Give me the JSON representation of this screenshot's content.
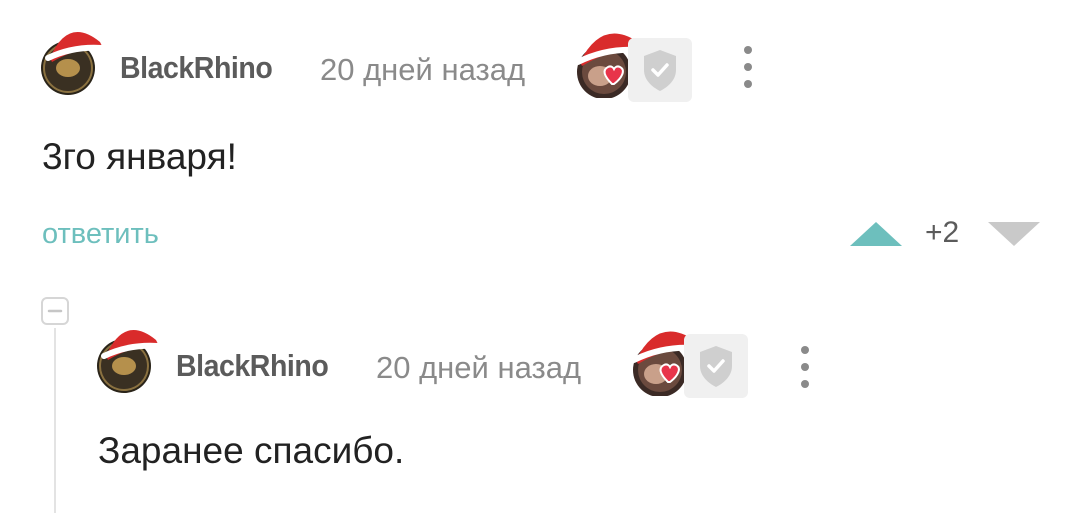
{
  "comments": [
    {
      "username": "BlackRhino",
      "time": "20 дней назад",
      "text": "3го января!",
      "reply_label": "ответить",
      "rating": "+2"
    },
    {
      "username": "BlackRhino",
      "time": "20 дней назад",
      "text": "Заранее спасибо."
    }
  ],
  "colors": {
    "accent_teal": "#6dbfbd",
    "vote_up": "#6dbfbd",
    "vote_down": "#c9c9c9",
    "santa_hat": "#d92b2b"
  },
  "icons": {
    "collapse": "minus-square-icon",
    "shield": "shield-check-icon",
    "more": "kebab-menu-icon",
    "vote_up": "triangle-up-icon",
    "vote_down": "triangle-down-icon"
  }
}
